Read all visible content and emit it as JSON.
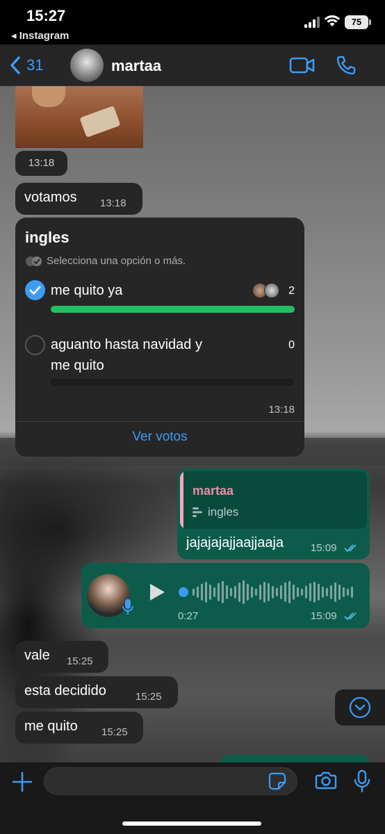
{
  "status_bar": {
    "time": "15:27",
    "back_app": "◂ Instagram",
    "battery": "75"
  },
  "header": {
    "back_count": "31",
    "contact_name": "martaa"
  },
  "messages": {
    "photo_time": "13:18",
    "votamos": {
      "text": "votamos",
      "time": "13:18"
    },
    "poll": {
      "title": "ingles",
      "hint": "Selecciona una opción o más.",
      "options": [
        {
          "text": "me quito ya",
          "count": "2",
          "selected": true,
          "fraction": 1.0
        },
        {
          "text_line1": "aguanto hasta navidad y",
          "text_line2": "me quito",
          "count": "0",
          "selected": false,
          "fraction": 0.0
        }
      ],
      "time": "13:18",
      "view_votes": "Ver votos"
    },
    "reply": {
      "quoted_author": "martaa",
      "quoted_text": "ingles",
      "text": "jajajajajjaajjaaja",
      "time": "15:09"
    },
    "voice": {
      "duration": "0:27",
      "time": "15:09"
    },
    "vale": {
      "text": "vale",
      "time": "15:25"
    },
    "decidido": {
      "text": "esta decidido",
      "time": "15:25"
    },
    "quito": {
      "text": "me quito",
      "time": "15:25"
    }
  },
  "composer": {
    "placeholder": ""
  },
  "colors": {
    "accent": "#3d9bf4",
    "outgoing_bubble": "#0d5c4b",
    "incoming_bubble": "#262626",
    "poll_bar": "#21c063",
    "quote_author": "#e68da7"
  },
  "icons": [
    "chevron-left-icon",
    "video-camera-icon",
    "phone-icon",
    "checkmark-icon",
    "play-icon",
    "microphone-icon",
    "double-check-icon",
    "plus-icon",
    "sticker-icon",
    "camera-icon",
    "chevron-down-icon",
    "wifi-icon",
    "signal-icon",
    "battery-icon"
  ]
}
